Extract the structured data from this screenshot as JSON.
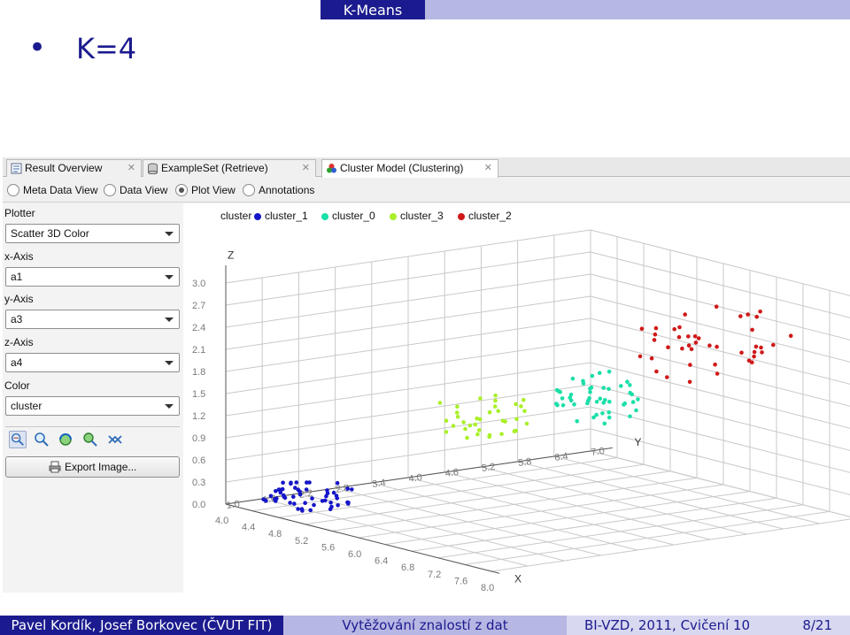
{
  "slide": {
    "header_title": "K-Means",
    "bullet": "•",
    "heading": "K=4"
  },
  "app": {
    "tabs": [
      {
        "label": "Result Overview",
        "icon": "result-overview-icon",
        "close": "✕"
      },
      {
        "label": "ExampleSet (Retrieve)",
        "icon": "database-icon",
        "close": "✕"
      },
      {
        "label": "Cluster Model (Clustering)",
        "icon": "cluster-model-icon",
        "close": "✕"
      }
    ],
    "views": [
      {
        "label": "Meta Data View",
        "selected": false
      },
      {
        "label": "Data View",
        "selected": false
      },
      {
        "label": "Plot View",
        "selected": true
      },
      {
        "label": "Annotations",
        "selected": false
      }
    ],
    "sidebar": {
      "plotter_label": "Plotter",
      "plotter_value": "Scatter 3D Color",
      "xaxis_label": "x-Axis",
      "xaxis_value": "a1",
      "yaxis_label": "y-Axis",
      "yaxis_value": "a3",
      "zaxis_label": "z-Axis",
      "zaxis_value": "a4",
      "color_label": "Color",
      "color_value": "cluster",
      "tools": [
        "select-zoom-icon",
        "zoom-icon",
        "rotate-icon",
        "pan-icon",
        "reset-icon"
      ],
      "export_label": "Export Image..."
    }
  },
  "chart_data": {
    "type": "scatter",
    "legend_title": "cluster",
    "legend_position": "top",
    "series": [
      {
        "name": "cluster_1",
        "color": "#1515c8"
      },
      {
        "name": "cluster_0",
        "color": "#19dfa8"
      },
      {
        "name": "cluster_3",
        "color": "#a9f028"
      },
      {
        "name": "cluster_2",
        "color": "#d01818"
      }
    ],
    "x_axis": {
      "label": "X",
      "ticks": [
        "4.0",
        "4.4",
        "4.8",
        "5.2",
        "5.6",
        "6.0",
        "6.4",
        "6.8",
        "7.2",
        "7.6",
        "8.0"
      ]
    },
    "y_axis": {
      "label": "Y",
      "ticks": [
        "1.0",
        "1.6",
        "2.2",
        "2.8",
        "3.4",
        "4.0",
        "4.6",
        "5.2",
        "5.8",
        "6.4",
        "7.0"
      ]
    },
    "z_axis": {
      "label": "Z",
      "ticks": [
        "0.0",
        "0.3",
        "0.6",
        "0.9",
        "1.2",
        "1.5",
        "1.8",
        "2.1",
        "2.4",
        "2.7",
        "3.0"
      ]
    },
    "grid": true
  },
  "footer": {
    "authors": "Pavel Kordík, Josef Borkovec (ČVUT FIT)",
    "course_name": "Vytěžování znalostí z dat",
    "course_code": "BI-VZD, 2011, Cvičení 10",
    "page": "8/21"
  }
}
